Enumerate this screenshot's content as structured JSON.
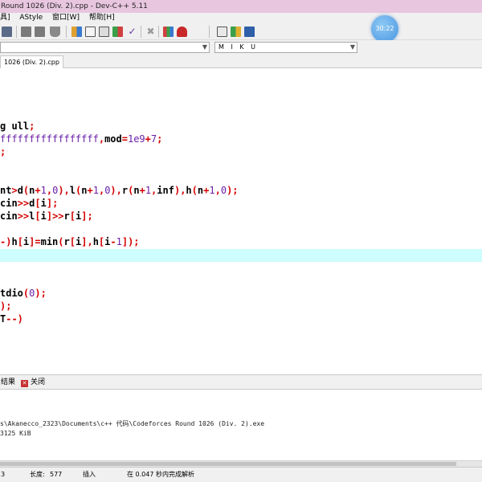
{
  "window": {
    "title": "Round 1026 (Div. 2).cpp - Dev-C++ 5.11"
  },
  "menu": [
    "具]",
    "AStyle",
    "窗口[W]",
    "帮助[H]"
  ],
  "clock": {
    "time": "30:22"
  },
  "combos": {
    "left": "",
    "right": "M I K U"
  },
  "tab": {
    "label": "1026 (Div. 2).cpp"
  },
  "editor": {
    "lines": [
      {
        "parts": [
          {
            "t": "g ",
            "c": "k"
          },
          {
            "t": "ull",
            "c": "k"
          },
          {
            "t": ";",
            "c": "p"
          }
        ]
      },
      {
        "parts": [
          {
            "t": "fffffffffffffffff",
            "c": "n"
          },
          {
            "t": ",",
            "c": "p"
          },
          {
            "t": "mod",
            "c": "k"
          },
          {
            "t": "=",
            "c": "p"
          },
          {
            "t": "1e9",
            "c": "n"
          },
          {
            "t": "+",
            "c": "p"
          },
          {
            "t": "7",
            "c": "n"
          },
          {
            "t": ";",
            "c": "p"
          }
        ]
      },
      {
        "parts": [
          {
            "t": ";",
            "c": "p"
          }
        ]
      },
      {
        "parts": [
          {
            "t": "nt",
            "c": "k"
          },
          {
            "t": ">",
            "c": "p"
          },
          {
            "t": "d",
            "c": "k"
          },
          {
            "t": "(",
            "c": "p"
          },
          {
            "t": "n",
            "c": "k"
          },
          {
            "t": "+",
            "c": "p"
          },
          {
            "t": "1",
            "c": "n"
          },
          {
            "t": ",",
            "c": "p"
          },
          {
            "t": "0",
            "c": "n"
          },
          {
            "t": "),",
            "c": "p"
          },
          {
            "t": "l",
            "c": "k"
          },
          {
            "t": "(",
            "c": "p"
          },
          {
            "t": "n",
            "c": "k"
          },
          {
            "t": "+",
            "c": "p"
          },
          {
            "t": "1",
            "c": "n"
          },
          {
            "t": ",",
            "c": "p"
          },
          {
            "t": "0",
            "c": "n"
          },
          {
            "t": "),",
            "c": "p"
          },
          {
            "t": "r",
            "c": "k"
          },
          {
            "t": "(",
            "c": "p"
          },
          {
            "t": "n",
            "c": "k"
          },
          {
            "t": "+",
            "c": "p"
          },
          {
            "t": "1",
            "c": "n"
          },
          {
            "t": ",",
            "c": "p"
          },
          {
            "t": "inf",
            "c": "k"
          },
          {
            "t": "),",
            "c": "p"
          },
          {
            "t": "h",
            "c": "k"
          },
          {
            "t": "(",
            "c": "p"
          },
          {
            "t": "n",
            "c": "k"
          },
          {
            "t": "+",
            "c": "p"
          },
          {
            "t": "1",
            "c": "n"
          },
          {
            "t": ",",
            "c": "p"
          },
          {
            "t": "0",
            "c": "n"
          },
          {
            "t": ");",
            "c": "p"
          }
        ]
      },
      {
        "parts": [
          {
            "t": "cin",
            "c": "k"
          },
          {
            "t": ">>",
            "c": "p"
          },
          {
            "t": "d",
            "c": "k"
          },
          {
            "t": "[",
            "c": "p"
          },
          {
            "t": "i",
            "c": "k"
          },
          {
            "t": "];",
            "c": "p"
          }
        ]
      },
      {
        "parts": [
          {
            "t": "cin",
            "c": "k"
          },
          {
            "t": ">>",
            "c": "p"
          },
          {
            "t": "l",
            "c": "k"
          },
          {
            "t": "[",
            "c": "p"
          },
          {
            "t": "i",
            "c": "k"
          },
          {
            "t": "]>>",
            "c": "p"
          },
          {
            "t": "r",
            "c": "k"
          },
          {
            "t": "[",
            "c": "p"
          },
          {
            "t": "i",
            "c": "k"
          },
          {
            "t": "];",
            "c": "p"
          }
        ]
      },
      {
        "parts": [
          {
            "t": "-)",
            "c": "p"
          },
          {
            "t": "h",
            "c": "k"
          },
          {
            "t": "[",
            "c": "p"
          },
          {
            "t": "i",
            "c": "k"
          },
          {
            "t": "]=",
            "c": "p"
          },
          {
            "t": "min",
            "c": "k"
          },
          {
            "t": "(",
            "c": "p"
          },
          {
            "t": "r",
            "c": "k"
          },
          {
            "t": "[",
            "c": "p"
          },
          {
            "t": "i",
            "c": "k"
          },
          {
            "t": "],",
            "c": "p"
          },
          {
            "t": "h",
            "c": "k"
          },
          {
            "t": "[",
            "c": "p"
          },
          {
            "t": "i",
            "c": "k"
          },
          {
            "t": "-",
            "c": "p"
          },
          {
            "t": "1",
            "c": "n"
          },
          {
            "t": "]);",
            "c": "p"
          }
        ]
      },
      {
        "parts": [
          {
            "t": "tdio",
            "c": "k"
          },
          {
            "t": "(",
            "c": "p"
          },
          {
            "t": "0",
            "c": "n"
          },
          {
            "t": ");",
            "c": "p"
          }
        ]
      },
      {
        "parts": [
          {
            "t": ");",
            "c": "p"
          }
        ]
      },
      {
        "parts": [
          {
            "t": "T",
            "c": "k"
          },
          {
            "t": "--)",
            "c": "p"
          }
        ]
      }
    ]
  },
  "panel": {
    "results_label": "结果",
    "close_label": "关闭"
  },
  "output": {
    "path_line": "s\\Akanecco_2323\\Documents\\c++ 代码\\Codeforces Round 1026 (Div. 2).exe",
    "memory_line": "3125 KiB"
  },
  "status": {
    "line": "3",
    "length_label": "长度:",
    "length_value": "577",
    "mode": "插入",
    "parse_msg": "在 0.047 秒内完成解析"
  }
}
